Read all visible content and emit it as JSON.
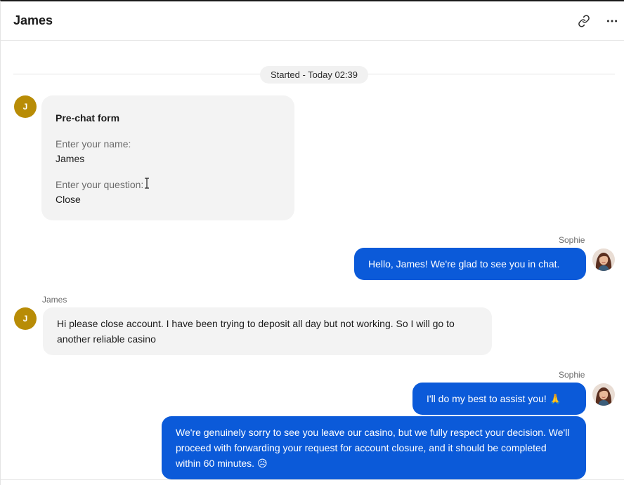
{
  "header": {
    "title": "James",
    "link_icon": "link-icon",
    "more_icon": "more-horizontal-icon"
  },
  "divider": {
    "label": "Started - Today 02:39"
  },
  "prechat": {
    "avatar_initial": "J",
    "title": "Pre-chat form",
    "fields": [
      {
        "question": "Enter your name:",
        "answer": "James"
      },
      {
        "question": "Enter your question:",
        "answer": "Close"
      }
    ]
  },
  "messages": [
    {
      "sender": "Sophie",
      "text": "Hello, James! We're glad to see you in chat."
    },
    {
      "sender": "James",
      "avatar_initial": "J",
      "text": "Hi please close account. I have been trying to deposit all day but not working. So I will go to another reliable casino"
    },
    {
      "sender": "Sophie",
      "text": "I'll do my best to assist you! 🙏"
    },
    {
      "text": "We're genuinely sorry to see you leave our casino, but we fully respect your decision. We'll proceed with forwarding your request for account closure, and it should be completed within 60 minutes. 😥"
    }
  ],
  "colors": {
    "agent_bubble": "#0b5ad9",
    "visitor_bubble": "#f3f3f3",
    "visitor_avatar": "#b88c06"
  }
}
